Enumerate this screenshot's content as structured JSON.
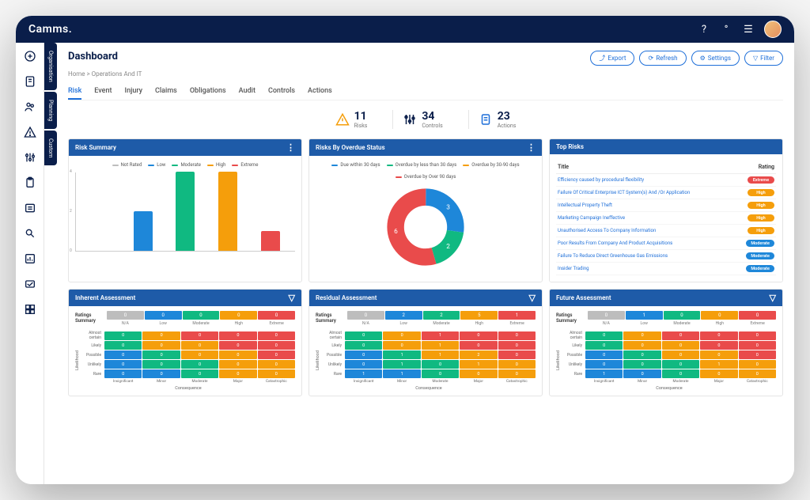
{
  "brand": "Camms.",
  "page_title": "Dashboard",
  "breadcrumb": "Home > Operations And IT",
  "header_buttons": {
    "export": "Export",
    "refresh": "Refresh",
    "settings": "Settings",
    "filter": "Filter"
  },
  "vert_tabs": [
    "Organisation",
    "Planning",
    "Custom"
  ],
  "tabs": [
    "Risk",
    "Event",
    "Injury",
    "Claims",
    "Obligations",
    "Audit",
    "Controls",
    "Actions"
  ],
  "active_tab": "Risk",
  "stats": [
    {
      "value": "11",
      "label": "Risks",
      "color": "#f59e0b"
    },
    {
      "value": "34",
      "label": "Controls",
      "color": "#0a1e4a"
    },
    {
      "value": "23",
      "label": "Actions",
      "color": "#1e6fd9"
    }
  ],
  "cards": {
    "risk_summary": {
      "title": "Risk Summary"
    },
    "overdue": {
      "title": "Risks By Overdue Status"
    },
    "top_risks": {
      "title": "Top Risks",
      "col_title": "Title",
      "col_rating": "Rating"
    },
    "inherent": {
      "title": "Inherent Assessment"
    },
    "residual": {
      "title": "Residual Assessment"
    },
    "future": {
      "title": "Future Assessment"
    }
  },
  "risk_summary_legend": [
    {
      "label": "Not Rated",
      "color": "#bdbdbd"
    },
    {
      "label": "Low",
      "color": "#1e87d9"
    },
    {
      "label": "Moderate",
      "color": "#10b981"
    },
    {
      "label": "High",
      "color": "#f59e0b"
    },
    {
      "label": "Extreme",
      "color": "#e94b4b"
    }
  ],
  "overdue_legend": [
    {
      "label": "Due within 30 days",
      "color": "#1e87d9"
    },
    {
      "label": "Overdue by less than 30 days",
      "color": "#10b981"
    },
    {
      "label": "Overdue by 30-90 days",
      "color": "#f59e0b"
    },
    {
      "label": "Overdue by Over 90 days",
      "color": "#e94b4b"
    }
  ],
  "top_risks": [
    {
      "title": "Efficiency caused by procedural flexibility",
      "rating": "Extreme",
      "class": "rating-extreme"
    },
    {
      "title": "Failure Of Critical Enterprise ICT System(s) And /Or Application",
      "rating": "High",
      "class": "rating-high"
    },
    {
      "title": "Intellectual Property Theft",
      "rating": "High",
      "class": "rating-high"
    },
    {
      "title": "Marketing Campaign Ineffective",
      "rating": "High",
      "class": "rating-high"
    },
    {
      "title": "Unauthorised Access To Company Information",
      "rating": "High",
      "class": "rating-high"
    },
    {
      "title": "Poor Results From Company And Product Acquisitions",
      "rating": "Moderate",
      "class": "rating-moderate"
    },
    {
      "title": "Failure To Reduce Direct Greenhouse Gas Emissions",
      "rating": "Moderate",
      "class": "rating-moderate"
    },
    {
      "title": "Insider Trading",
      "rating": "Moderate",
      "class": "rating-moderate"
    }
  ],
  "ratings_summary_label": "Ratings\nSummary",
  "summary_labels": [
    "N/A",
    "Low",
    "Moderate",
    "High",
    "Extreme"
  ],
  "likelihood_labels": [
    "Almost certain",
    "Likely",
    "Possible",
    "Unlikely",
    "Rare"
  ],
  "consequence_labels": [
    "Insignificant",
    "Minor",
    "Moderate",
    "Major",
    "Catastrophic"
  ],
  "axis_y": "Likelihood",
  "axis_x": "Consequence",
  "inherent_summary": [
    {
      "v": "0",
      "c": "c-na"
    },
    {
      "v": "0",
      "c": "c-low"
    },
    {
      "v": "0",
      "c": "c-mod"
    },
    {
      "v": "0",
      "c": "c-high"
    },
    {
      "v": "0",
      "c": "c-ext"
    }
  ],
  "residual_summary": [
    {
      "v": "0",
      "c": "c-na"
    },
    {
      "v": "2",
      "c": "c-low"
    },
    {
      "v": "2",
      "c": "c-mod"
    },
    {
      "v": "5",
      "c": "c-high"
    },
    {
      "v": "1",
      "c": "c-ext"
    }
  ],
  "future_summary": [
    {
      "v": "0",
      "c": "c-na"
    },
    {
      "v": "1",
      "c": "c-low"
    },
    {
      "v": "0",
      "c": "c-mod"
    },
    {
      "v": "0",
      "c": "c-high"
    },
    {
      "v": "0",
      "c": "c-ext"
    }
  ],
  "inherent_matrix": [
    [
      {
        "v": "0",
        "c": "c-mod"
      },
      {
        "v": "0",
        "c": "c-high"
      },
      {
        "v": "0",
        "c": "c-ext"
      },
      {
        "v": "0",
        "c": "c-ext"
      },
      {
        "v": "0",
        "c": "c-ext"
      }
    ],
    [
      {
        "v": "0",
        "c": "c-mod"
      },
      {
        "v": "0",
        "c": "c-high"
      },
      {
        "v": "0",
        "c": "c-high"
      },
      {
        "v": "0",
        "c": "c-ext"
      },
      {
        "v": "0",
        "c": "c-ext"
      }
    ],
    [
      {
        "v": "0",
        "c": "c-low"
      },
      {
        "v": "0",
        "c": "c-mod"
      },
      {
        "v": "0",
        "c": "c-high"
      },
      {
        "v": "0",
        "c": "c-high"
      },
      {
        "v": "0",
        "c": "c-ext"
      }
    ],
    [
      {
        "v": "0",
        "c": "c-low"
      },
      {
        "v": "0",
        "c": "c-mod"
      },
      {
        "v": "0",
        "c": "c-mod"
      },
      {
        "v": "0",
        "c": "c-high"
      },
      {
        "v": "0",
        "c": "c-high"
      }
    ],
    [
      {
        "v": "0",
        "c": "c-low"
      },
      {
        "v": "0",
        "c": "c-low"
      },
      {
        "v": "0",
        "c": "c-mod"
      },
      {
        "v": "0",
        "c": "c-high"
      },
      {
        "v": "0",
        "c": "c-high"
      }
    ]
  ],
  "residual_matrix": [
    [
      {
        "v": "0",
        "c": "c-mod"
      },
      {
        "v": "0",
        "c": "c-high"
      },
      {
        "v": "1",
        "c": "c-ext"
      },
      {
        "v": "0",
        "c": "c-ext"
      },
      {
        "v": "0",
        "c": "c-ext"
      }
    ],
    [
      {
        "v": "0",
        "c": "c-mod"
      },
      {
        "v": "0",
        "c": "c-high"
      },
      {
        "v": "1",
        "c": "c-high"
      },
      {
        "v": "0",
        "c": "c-ext"
      },
      {
        "v": "0",
        "c": "c-ext"
      }
    ],
    [
      {
        "v": "0",
        "c": "c-low"
      },
      {
        "v": "1",
        "c": "c-mod"
      },
      {
        "v": "1",
        "c": "c-high"
      },
      {
        "v": "2",
        "c": "c-high"
      },
      {
        "v": "0",
        "c": "c-ext"
      }
    ],
    [
      {
        "v": "0",
        "c": "c-low"
      },
      {
        "v": "1",
        "c": "c-mod"
      },
      {
        "v": "0",
        "c": "c-mod"
      },
      {
        "v": "1",
        "c": "c-high"
      },
      {
        "v": "0",
        "c": "c-high"
      }
    ],
    [
      {
        "v": "1",
        "c": "c-low"
      },
      {
        "v": "1",
        "c": "c-low"
      },
      {
        "v": "0",
        "c": "c-mod"
      },
      {
        "v": "0",
        "c": "c-high"
      },
      {
        "v": "0",
        "c": "c-high"
      }
    ]
  ],
  "future_matrix": [
    [
      {
        "v": "0",
        "c": "c-mod"
      },
      {
        "v": "0",
        "c": "c-high"
      },
      {
        "v": "0",
        "c": "c-ext"
      },
      {
        "v": "0",
        "c": "c-ext"
      },
      {
        "v": "0",
        "c": "c-ext"
      }
    ],
    [
      {
        "v": "0",
        "c": "c-mod"
      },
      {
        "v": "0",
        "c": "c-high"
      },
      {
        "v": "0",
        "c": "c-high"
      },
      {
        "v": "0",
        "c": "c-ext"
      },
      {
        "v": "0",
        "c": "c-ext"
      }
    ],
    [
      {
        "v": "0",
        "c": "c-low"
      },
      {
        "v": "0",
        "c": "c-mod"
      },
      {
        "v": "0",
        "c": "c-high"
      },
      {
        "v": "0",
        "c": "c-high"
      },
      {
        "v": "0",
        "c": "c-ext"
      }
    ],
    [
      {
        "v": "0",
        "c": "c-low"
      },
      {
        "v": "0",
        "c": "c-mod"
      },
      {
        "v": "0",
        "c": "c-mod"
      },
      {
        "v": "1",
        "c": "c-high"
      },
      {
        "v": "0",
        "c": "c-high"
      }
    ],
    [
      {
        "v": "1",
        "c": "c-low"
      },
      {
        "v": "0",
        "c": "c-low"
      },
      {
        "v": "0",
        "c": "c-mod"
      },
      {
        "v": "0",
        "c": "c-high"
      },
      {
        "v": "0",
        "c": "c-high"
      }
    ]
  ],
  "chart_data": {
    "risk_summary_bar": {
      "type": "bar",
      "categories": [
        "Not Rated",
        "Low",
        "Moderate",
        "High",
        "Extreme"
      ],
      "values": [
        0,
        2,
        4,
        4,
        1
      ],
      "colors": [
        "#bdbdbd",
        "#1e87d9",
        "#10b981",
        "#f59e0b",
        "#e94b4b"
      ],
      "ylim": [
        0,
        4
      ],
      "title": "Risk Summary"
    },
    "overdue_donut": {
      "type": "pie",
      "series": [
        {
          "name": "Due within 30 days",
          "value": 3,
          "color": "#1e87d9"
        },
        {
          "name": "Overdue by less than 30 days",
          "value": 2,
          "color": "#10b981"
        },
        {
          "name": "Overdue by 30-90 days",
          "value": 0,
          "color": "#f59e0b"
        },
        {
          "name": "Overdue by Over 90 days",
          "value": 6,
          "color": "#e94b4b"
        }
      ],
      "title": "Risks By Overdue Status"
    }
  }
}
